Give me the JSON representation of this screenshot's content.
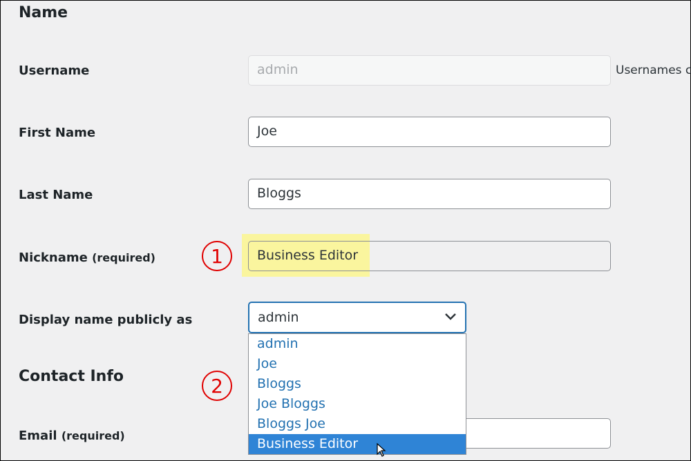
{
  "sections": {
    "name_title": "Name",
    "contact_title": "Contact Info"
  },
  "fields": {
    "username": {
      "label": "Username",
      "value": "admin",
      "note": "Usernames c"
    },
    "first_name": {
      "label": "First Name",
      "value": "Joe"
    },
    "last_name": {
      "label": "Last Name",
      "value": "Bloggs"
    },
    "nickname": {
      "label": "Nickname",
      "required": "(required)",
      "value": "Business Editor"
    },
    "display_name": {
      "label": "Display name publicly as",
      "value": "admin",
      "options": [
        "admin",
        "Joe",
        "Bloggs",
        "Joe Bloggs",
        "Bloggs Joe",
        "Business Editor"
      ]
    },
    "email": {
      "label": "Email",
      "required": "(required)",
      "value": ""
    }
  },
  "annotations": {
    "step1": "1",
    "step2": "2",
    "color": "#e00000"
  },
  "colors": {
    "accent": "#2271b1",
    "selected_option": "#2f84d6",
    "highlight": "#fcf68f"
  }
}
